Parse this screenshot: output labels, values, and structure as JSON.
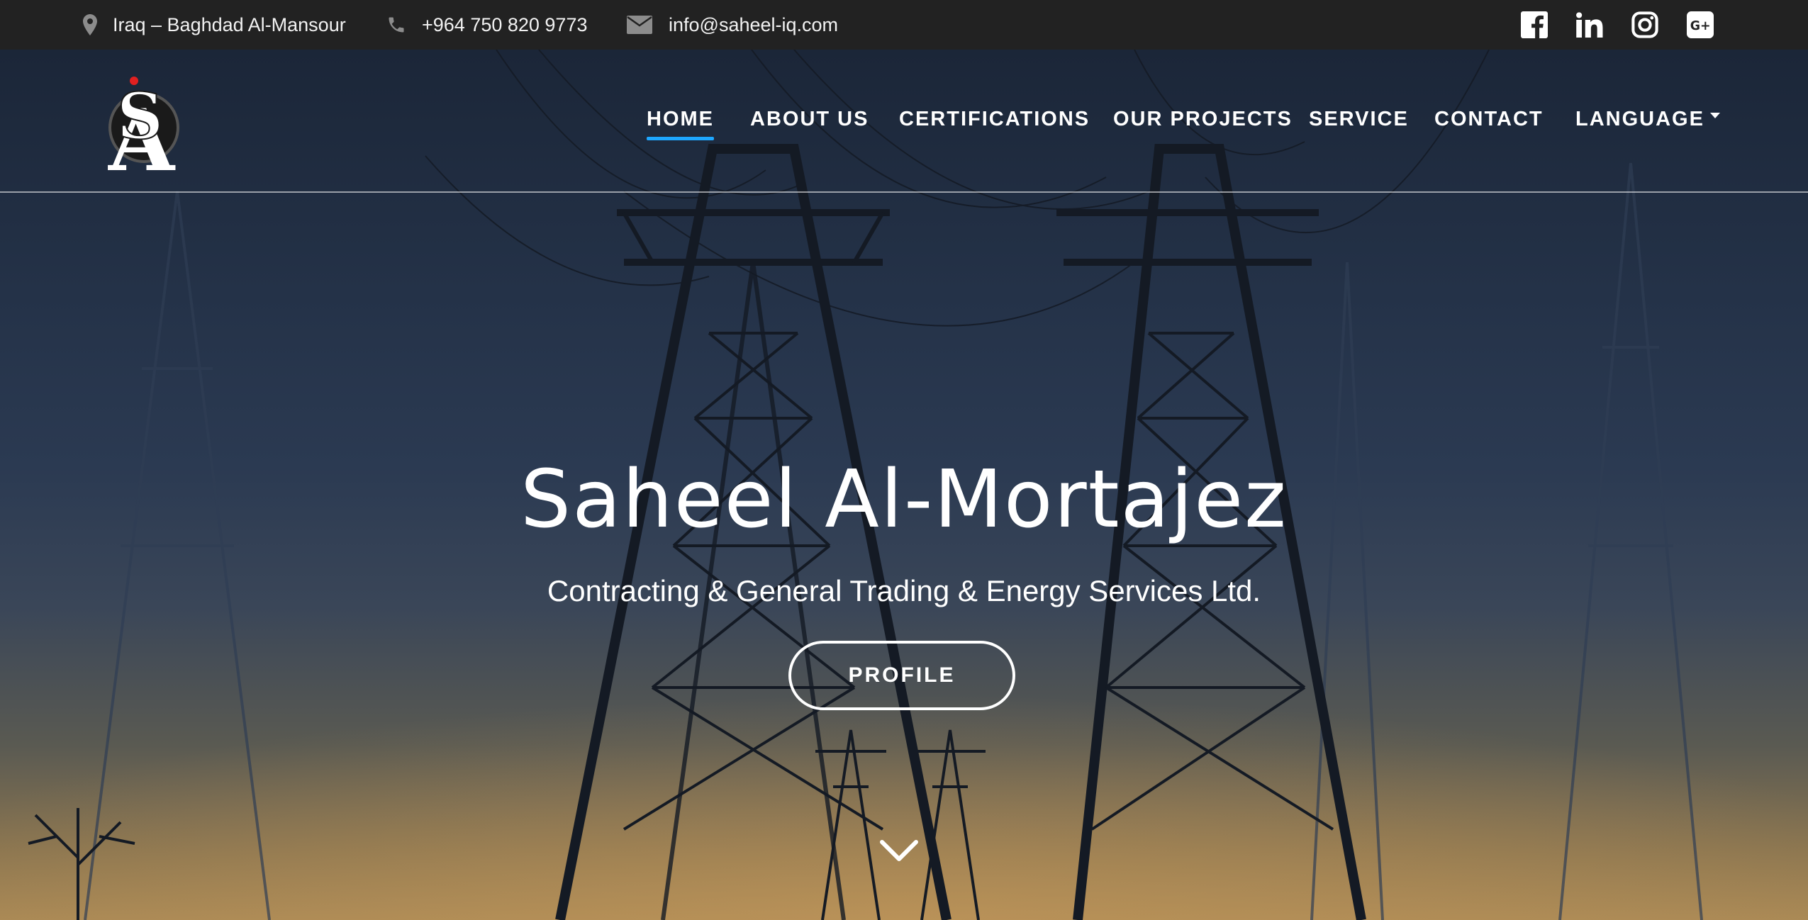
{
  "topbar": {
    "location": "Iraq – Baghdad Al-Mansour",
    "phone": "+964 750 820 9773",
    "email": "info@saheel-iq.com",
    "social": [
      "facebook-icon",
      "linkedin-icon",
      "instagram-icon",
      "google-plus-icon"
    ]
  },
  "nav": {
    "items": [
      {
        "label": "HOME",
        "active": true
      },
      {
        "label": "ABOUT US"
      },
      {
        "label": "CERTIFICATIONS"
      },
      {
        "label": "OUR PROJECTS"
      },
      {
        "label": "SERVICE"
      },
      {
        "label": "CONTACT"
      },
      {
        "label": "LANGUAGE"
      }
    ],
    "active_color": "#1ea7ff"
  },
  "hero": {
    "title": "Saheel Al-Mortajez",
    "subtitle": "Contracting & General Trading & Energy Services Ltd.",
    "button": "PROFILE"
  },
  "colors": {
    "topbar_bg": "#222222",
    "accent": "#1ea7ff"
  }
}
